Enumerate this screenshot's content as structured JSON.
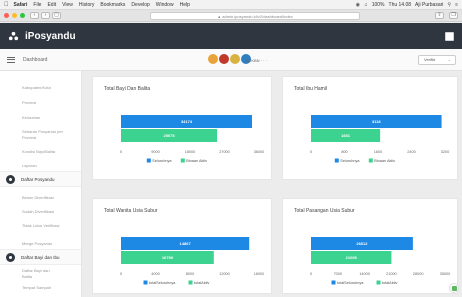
{
  "os_menu": {
    "items": [
      "Safari",
      "File",
      "Edit",
      "View",
      "History",
      "Bookmarks",
      "Develop",
      "Window",
      "Help"
    ],
    "battery": "100%",
    "clock": "Thu 14.08",
    "user": "Aji Purbasari"
  },
  "browser": {
    "url": "▲ admin.iposyandu.id/v2/dashboard/index",
    "back": "‹",
    "forward": "›"
  },
  "app": {
    "title": "iPosyandu"
  },
  "subheader": {
    "dashboard_label": "Dashboard",
    "emblem_text": "BKKBN · · ·",
    "select_value": "Verifkt"
  },
  "sidebar": {
    "items_top": [
      "Kabupaten/Kota",
      "Provinsi",
      "Kelurahan",
      "Sebaran Posyandu per Provinsi",
      "Kondisi Bayi/Balita",
      "Laporan"
    ],
    "group1": "Daftar Posyandu",
    "items_mid": [
      "Belum Diverifikasi",
      "Sudah Diverifikasi",
      "Tidak Lolos Verifikasi",
      "Merge Posyandu"
    ],
    "group2": "Daftar Bayi dan Ibu",
    "items_bot": [
      "Daftar Bayi dan Balita",
      "Tempat Sampah"
    ]
  },
  "colors": {
    "blue": "#1e88e5",
    "green": "#3cd28f",
    "header": "#2f3640"
  },
  "chart_data": [
    {
      "type": "bar",
      "title": "Total Bayi Dan Balita",
      "series": [
        {
          "name": "Seluruhnya",
          "values": [
            34174
          ]
        },
        {
          "name": "Binaan Aktiv",
          "values": [
            25075
          ]
        }
      ],
      "ticks": [
        0,
        9000,
        18000,
        27000,
        36000
      ],
      "legend": [
        "Seluruhnya",
        "Binaan Aktiv"
      ],
      "xlim": [
        0,
        36000
      ]
    },
    {
      "type": "bar",
      "title": "Total Ibu Hamil",
      "series": [
        {
          "name": "Seluruhnya",
          "values": [
            3118
          ]
        },
        {
          "name": "Binaan Aktiv",
          "values": [
            1651
          ]
        }
      ],
      "ticks": [
        0,
        800,
        1600,
        2400,
        3200
      ],
      "legend": [
        "Seluruhnya",
        "Binaan Aktiv"
      ],
      "xlim": [
        0,
        3200
      ]
    },
    {
      "type": "bar",
      "title": "Total Wanita Usia Subur",
      "series": [
        {
          "name": "totalSeluruhnya",
          "values": [
            14867
          ]
        },
        {
          "name": "totalAktiv",
          "values": [
            10759
          ]
        }
      ],
      "ticks": [
        0,
        4000,
        8000,
        12000,
        16000
      ],
      "legend": [
        "totalSeluruhnya",
        "totalAktiv"
      ],
      "xlim": [
        0,
        16000
      ]
    },
    {
      "type": "bar",
      "title": "Total Pasangan Usia Subur",
      "series": [
        {
          "name": "totalSeluruhnya",
          "values": [
            26612
          ]
        },
        {
          "name": "totalAktiv",
          "values": [
            21005
          ]
        }
      ],
      "ticks": [
        0,
        7000,
        14000,
        21000,
        28000,
        35000
      ],
      "legend": [
        "totalSeluruhnya",
        "totalAktiv"
      ],
      "xlim": [
        0,
        35000
      ]
    }
  ]
}
